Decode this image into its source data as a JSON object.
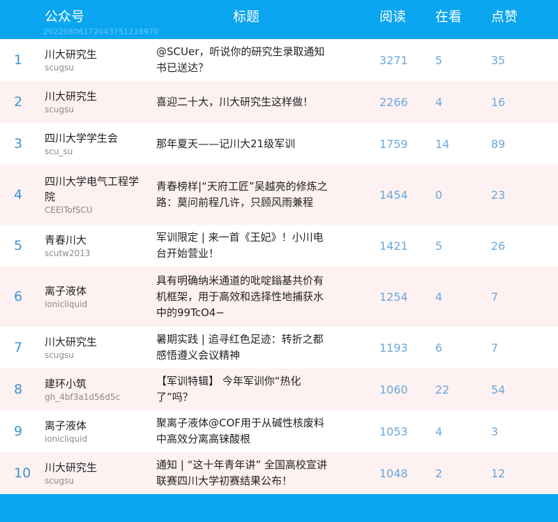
{
  "header": {
    "account_label": "公众号",
    "title_label": "标题",
    "read_label": "阅读",
    "watch_label": "在看",
    "like_label": "点赞",
    "stamp": "20220806172043751218970"
  },
  "colors": {
    "header": "#0aa5ef",
    "alt_row": "#fdf1f1",
    "numbers": "#6aa8db"
  },
  "rows": [
    {
      "rank": "1",
      "name": "川大研究生",
      "id": "scugsu",
      "title": "@SCUer，听说你的研究生录取通知书已送达？",
      "read": "3271",
      "watch": "5",
      "like": "35"
    },
    {
      "rank": "2",
      "name": "川大研究生",
      "id": "scugsu",
      "title": "喜迎二十大，川大研究生这样做！",
      "read": "2266",
      "watch": "4",
      "like": "16"
    },
    {
      "rank": "3",
      "name": "四川大学学生会",
      "id": "scu_su",
      "title": "那年夏天——记川大21级军训",
      "read": "1759",
      "watch": "14",
      "like": "89"
    },
    {
      "rank": "4",
      "name": "四川大学电气工程学院",
      "id": "CEEITofSCU",
      "title": "青春榜样|“天府工匠”吴越亮的修炼之路：莫问前程几许，只顾风雨兼程",
      "read": "1454",
      "watch": "0",
      "like": "23"
    },
    {
      "rank": "5",
      "name": "青春川大",
      "id": "scutw2013",
      "title": "军训限定 | 来一首《王妃》！小川电台开始营业！",
      "read": "1421",
      "watch": "5",
      "like": "26"
    },
    {
      "rank": "6",
      "name": "离子液体",
      "id": "ionicliquid",
      "title": "具有明确纳米通道的吡啶鎓基共价有机框架，用于高效和选择性地捕获水中的99TcO4−",
      "read": "1254",
      "watch": "4",
      "like": "7"
    },
    {
      "rank": "7",
      "name": "川大研究生",
      "id": "scugsu",
      "title": "暑期实践 | 追寻红色足迹：转折之都感悟遵义会议精神",
      "read": "1193",
      "watch": "6",
      "like": "7"
    },
    {
      "rank": "8",
      "name": "建环小筑",
      "id": "gh_4bf3a1d56d5c",
      "title": "【军训特辑】 今年军训你“热化了”吗？",
      "read": "1060",
      "watch": "22",
      "like": "54"
    },
    {
      "rank": "9",
      "name": "离子液体",
      "id": "ionicliquid",
      "title": "聚离子液体@COF用于从碱性核废料中高效分离高铼酸根",
      "read": "1053",
      "watch": "4",
      "like": "3"
    },
    {
      "rank": "10",
      "name": "川大研究生",
      "id": "scugsu",
      "title": "通知 | “这十年青年讲” 全国高校宣讲联赛四川大学初赛结果公布！",
      "read": "1048",
      "watch": "2",
      "like": "12"
    }
  ]
}
